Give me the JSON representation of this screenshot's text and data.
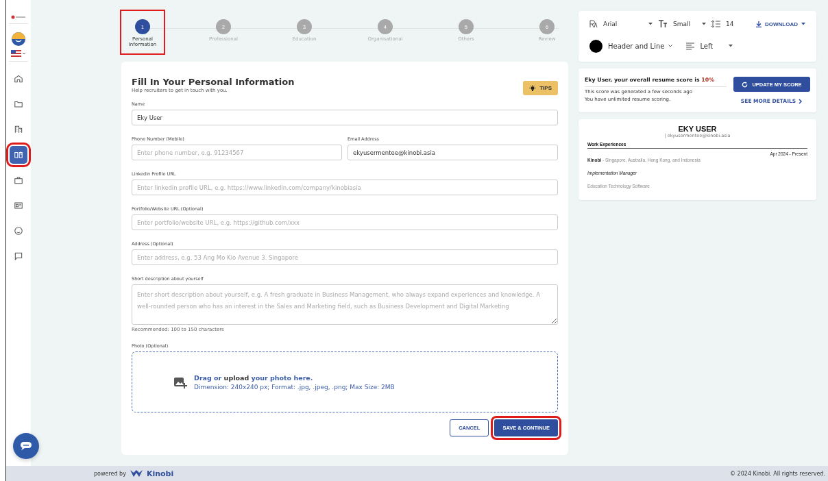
{
  "sidebar": {
    "items": [
      {
        "selected": false,
        "highlighted": false
      },
      {
        "selected": false,
        "highlighted": false
      },
      {
        "selected": false,
        "highlighted": false
      },
      {
        "selected": true,
        "highlighted": true
      },
      {
        "selected": false,
        "highlighted": false
      },
      {
        "selected": false,
        "highlighted": false
      },
      {
        "selected": false,
        "highlighted": false
      },
      {
        "selected": false,
        "highlighted": false
      }
    ]
  },
  "stepper": {
    "steps": [
      {
        "number": "1",
        "label": "Personal Information",
        "selected": true,
        "highlighted": true
      },
      {
        "number": "2",
        "label": "Professional",
        "selected": false,
        "highlighted": false
      },
      {
        "number": "3",
        "label": "Education",
        "selected": false,
        "highlighted": false
      },
      {
        "number": "4",
        "label": "Organisational",
        "selected": false,
        "highlighted": false
      },
      {
        "number": "5",
        "label": "Others",
        "selected": false,
        "highlighted": false
      },
      {
        "number": "6",
        "label": "Review",
        "selected": false,
        "highlighted": false
      }
    ]
  },
  "form": {
    "title": "Fill In Your Personal Information",
    "subtitle": "Help recruiters to get in touch with you.",
    "tips": "TIPS",
    "rows": [
      [
        {
          "kind": "text",
          "label": "Name",
          "value": "Eky User"
        }
      ],
      [
        {
          "kind": "text",
          "label": "Phone Number (Mobile)",
          "placeholder": "Enter phone number, e.g. 91234567"
        },
        {
          "kind": "text",
          "label": "Email Address",
          "value": "ekyusermentee@kinobi.asia"
        }
      ],
      [
        {
          "kind": "text",
          "label": "Linkedin Profile URL",
          "placeholder": "Enter linkedin profile URL, e.g. https://www.linkedin.com/company/kinobiasia"
        }
      ],
      [
        {
          "kind": "text",
          "label": "Portfolio/Website URL (Optional)",
          "placeholder": "Enter portfolio/website URL, e.g. https://github.com/xxx"
        }
      ],
      [
        {
          "kind": "text",
          "label": "Address (Optional)",
          "placeholder": "Enter address, e.g. 53 Ang Mo Kio Avenue 3. Singapore"
        }
      ],
      [
        {
          "kind": "textarea",
          "label": "Short description about yourself",
          "placeholder": "Enter short description about yourself, e.g. A fresh graduate in Business Management, who always expand experiences and knowledge. A well-rounded person who has an interest in the Sales and Marketing field, such as Business Development and Digital Marketing",
          "hint": "Recommended: 100 to 150 characters"
        }
      ]
    ],
    "photo": {
      "label": "Photo (Optional)",
      "parts": [
        {
          "text": "Drag or",
          "accent": true
        },
        {
          "text": "upload",
          "accent": false
        },
        {
          "text": "your photo here.",
          "accent": true
        }
      ],
      "details": "Dimension: 240x240 px; Format: .jpg, .jpeg, .png; Max Size: 2MB"
    },
    "cancel": {
      "label": "CANCEL",
      "highlighted": false
    },
    "save": {
      "label": "SAVE & CONTINUE",
      "highlighted": true
    }
  },
  "toolbar": {
    "font": "Arial",
    "size": "Small",
    "spacing": "14",
    "download": "DOWNLOAD",
    "color_label": "Header and Line",
    "color": "#000000",
    "align": "Left"
  },
  "score": {
    "text": "Eky User, your overall resume score is ",
    "value": "10%",
    "lines": [
      "This score was generated a few seconds ago",
      "You have unlimited resume scoring."
    ],
    "update": "UPDATE MY SCORE",
    "details": "SEE MORE DETAILS"
  },
  "preview": {
    "name": "EKY USER",
    "contact": "| ekyusermentee@kinobi.asia",
    "section": "Work Experiences",
    "company": "Kinobi",
    "location": " - Singapore, Australia, Hong Kong, and Indonesia",
    "date": "Apr 2024 - Present",
    "role": "Implementation Manager",
    "industry": "Education Technology Software"
  },
  "footer": {
    "powered": "powered by",
    "brand": "Kinobi",
    "copyright": "© 2024 Kinobi. All rights reserved."
  }
}
